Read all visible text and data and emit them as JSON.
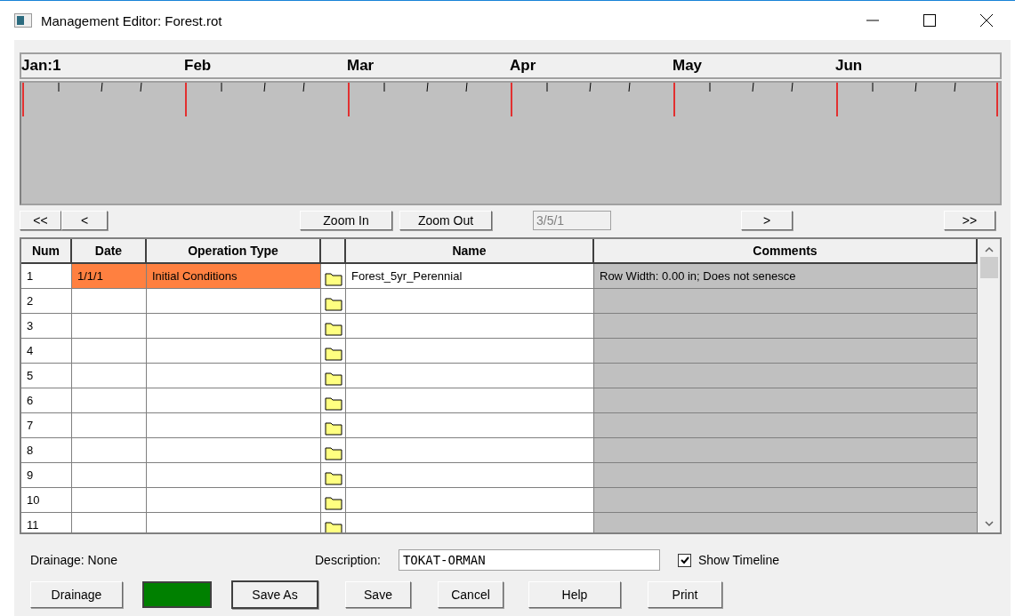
{
  "window": {
    "title": "Management Editor: Forest.rot"
  },
  "timeline": {
    "months": [
      "Jan:1",
      "Feb",
      "Mar",
      "Apr",
      "May",
      "Jun"
    ]
  },
  "navigation": {
    "first": "<<",
    "previous": "<",
    "zoom_in": "Zoom In",
    "zoom_out": "Zoom Out",
    "date": "3/5/1",
    "next": ">",
    "last": ">>"
  },
  "table": {
    "columns": [
      "Num",
      "Date",
      "Operation Type",
      "Name",
      "Comments"
    ],
    "rows": [
      {
        "num": "1",
        "date": "1/1/1",
        "operation_type": "Initial Conditions",
        "name": "Forest_5yr_Perennial",
        "comments": "Row Width: 0.00 in; Does not senesce",
        "selected": true
      },
      {
        "num": "2",
        "selected": false
      },
      {
        "num": "3",
        "selected": false
      },
      {
        "num": "4",
        "selected": false
      },
      {
        "num": "5",
        "selected": false
      },
      {
        "num": "6",
        "selected": false
      },
      {
        "num": "7",
        "selected": false
      },
      {
        "num": "8",
        "selected": false
      },
      {
        "num": "9",
        "selected": false
      },
      {
        "num": "10",
        "selected": false
      },
      {
        "num": "11",
        "selected": false
      }
    ]
  },
  "drainage": "Drainage: None",
  "description": {
    "label": "Description:",
    "value": "TOKAT-ORMAN"
  },
  "show_timeline": {
    "label": "Show Timeline",
    "checked": true
  },
  "buttons": [
    "Drainage",
    "Save As",
    "Save",
    "Cancel",
    "Help",
    "Print"
  ]
}
